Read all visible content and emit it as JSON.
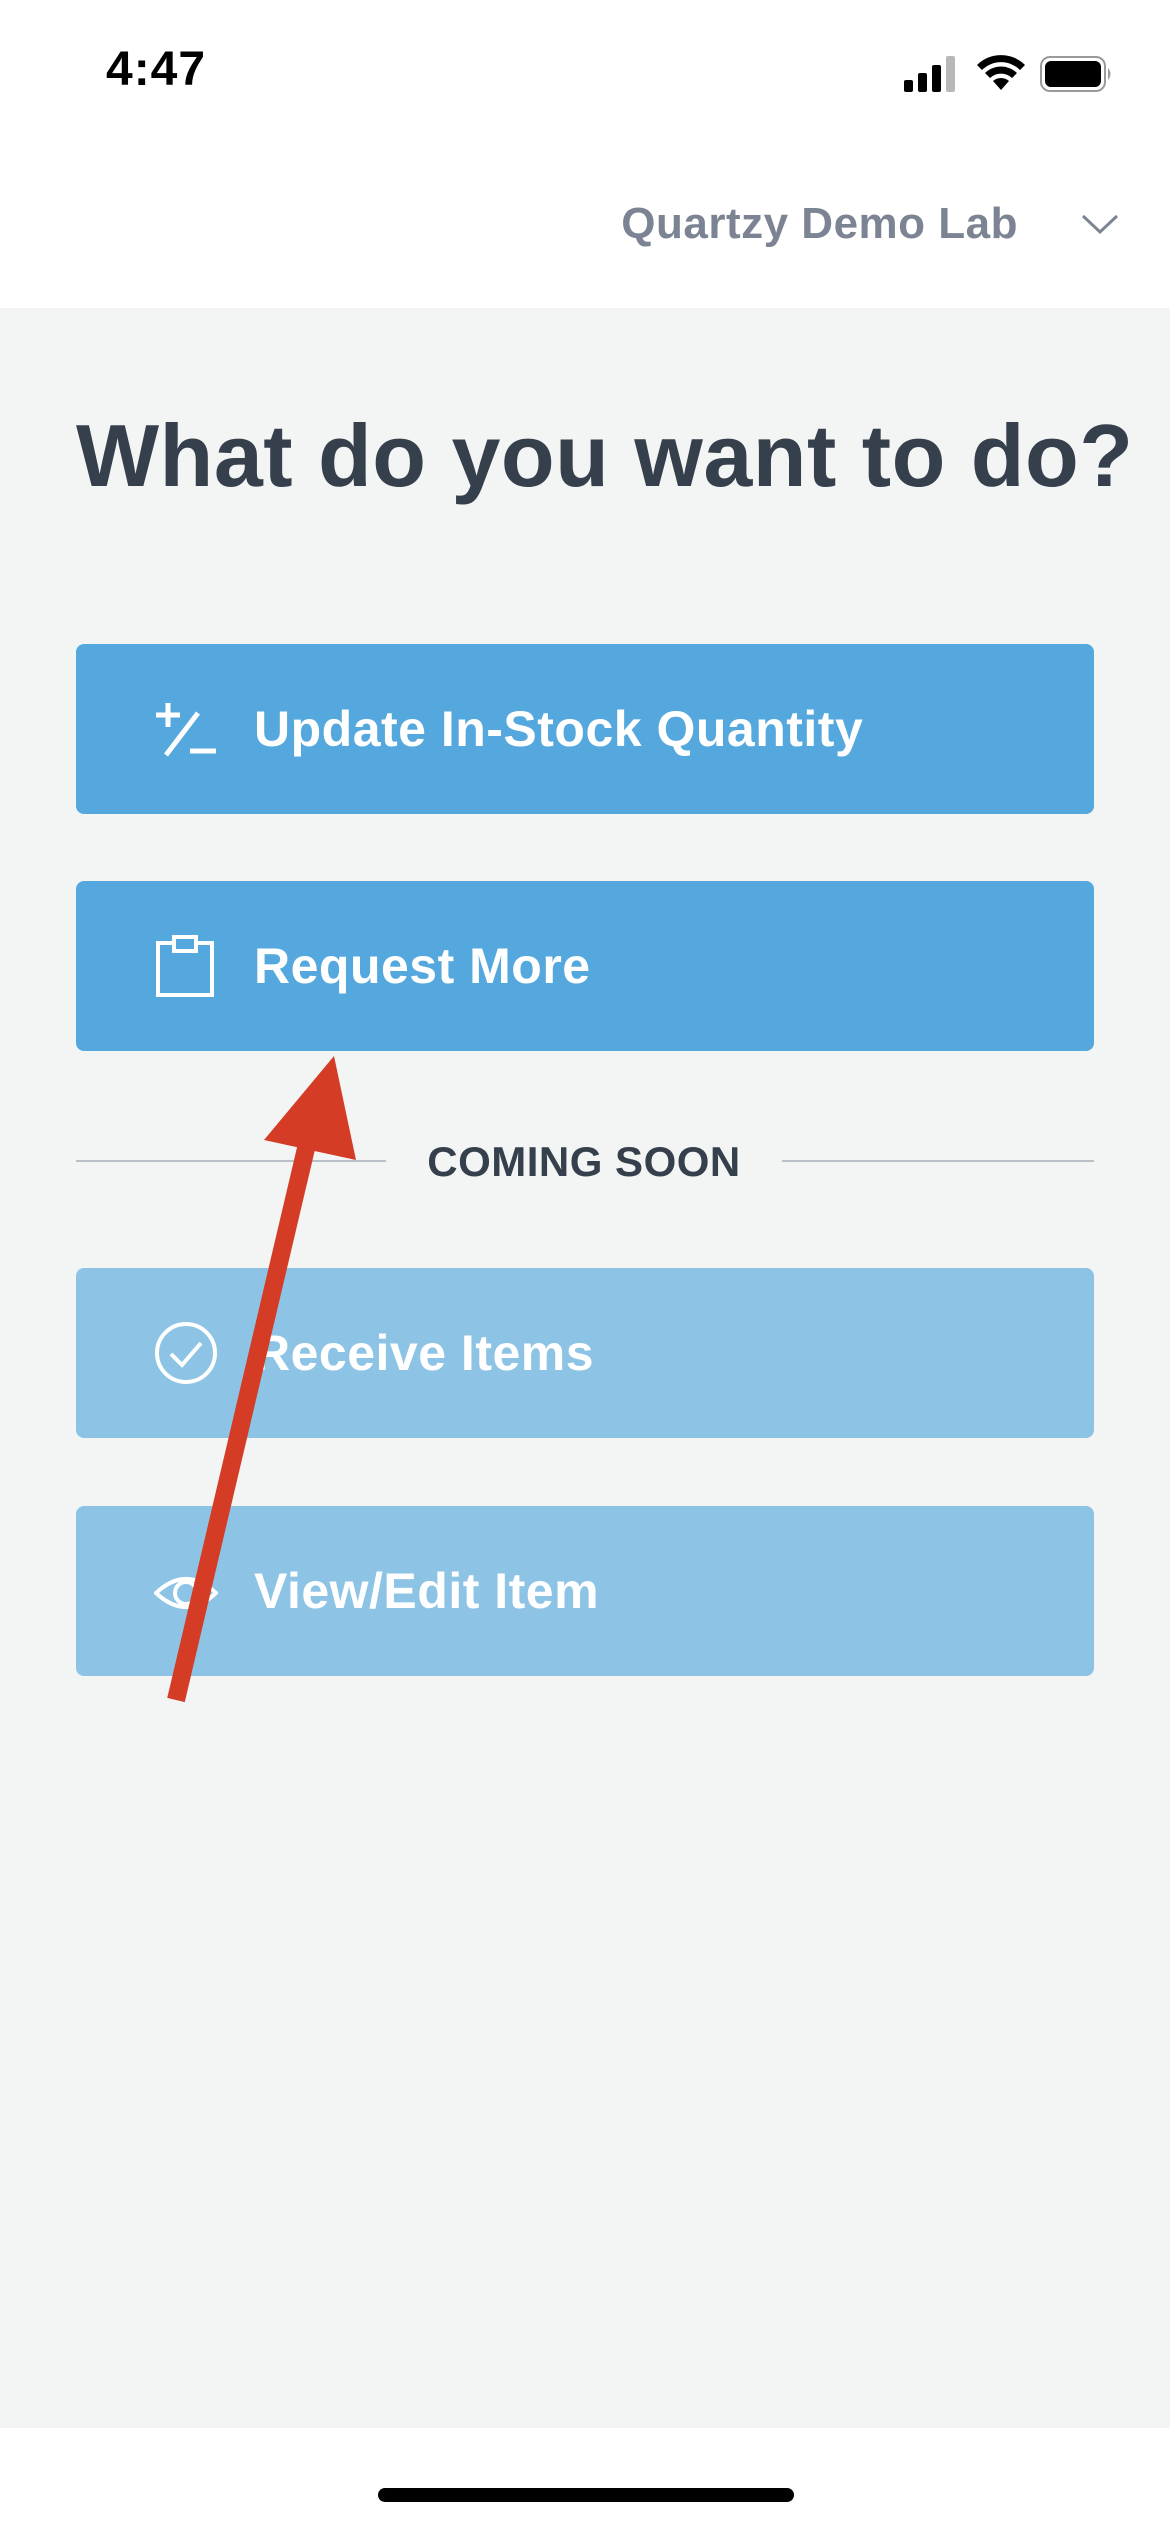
{
  "status_bar": {
    "time": "4:47",
    "icons": [
      "signal-icon",
      "wifi-icon",
      "battery-icon"
    ]
  },
  "header": {
    "lab_name": "Quartzy Demo Lab",
    "dropdown_icon": "chevron-down-icon"
  },
  "main": {
    "title": "What do you want to do?",
    "actions": [
      {
        "label": "Update In-Stock Quantity",
        "icon": "plus-minus-icon",
        "enabled": true
      },
      {
        "label": "Request More",
        "icon": "clipboard-icon",
        "enabled": true
      }
    ],
    "divider_label": "COMING SOON",
    "coming_soon": [
      {
        "label": "Receive Items",
        "icon": "check-circle-icon",
        "enabled": false
      },
      {
        "label": "View/Edit Item",
        "icon": "eye-icon",
        "enabled": false
      }
    ]
  },
  "annotation": {
    "type": "arrow",
    "color": "#d43c25",
    "points_to": "request-more-button"
  },
  "colors": {
    "primary_button": "#55a8dd",
    "disabled_button": "#8dc4e5",
    "title_text": "#36404c",
    "lab_text": "#7c8493",
    "background": "#f3f4f4"
  }
}
